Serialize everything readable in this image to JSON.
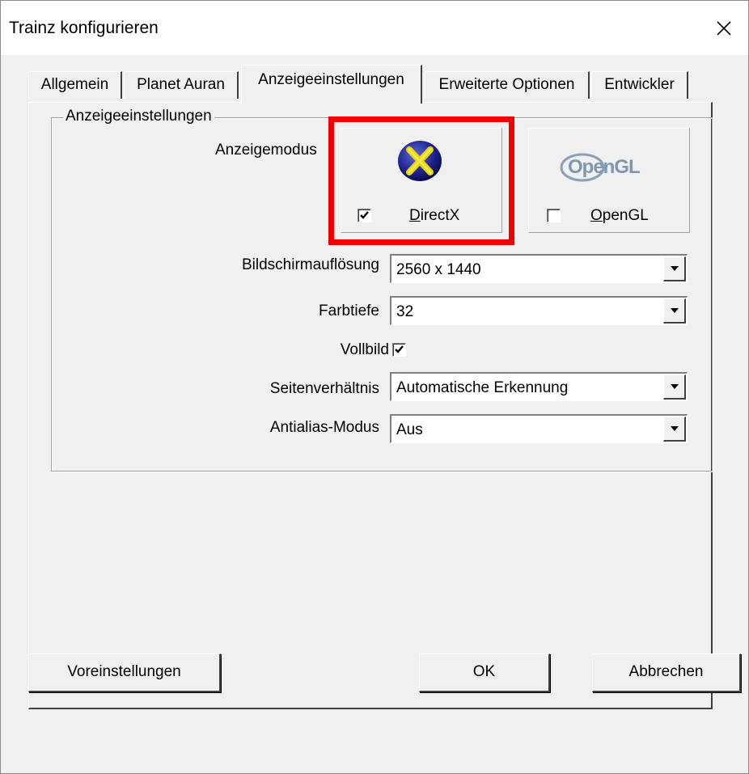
{
  "window": {
    "title": "Trainz konfigurieren"
  },
  "tabs": [
    {
      "label": "Allgemein"
    },
    {
      "label": "Planet Auran"
    },
    {
      "label": "Anzeigeeinstellungen",
      "active": true
    },
    {
      "label": "Erweiterte Optionen"
    },
    {
      "label": "Entwickler"
    }
  ],
  "group": {
    "title": "Anzeigeeinstellungen"
  },
  "display_mode": {
    "label": "Anzeigemodus",
    "directx": {
      "label_first": "D",
      "label_rest": "irectX",
      "checked": true,
      "icon": "directx-logo-icon"
    },
    "opengl": {
      "label_first": "O",
      "label_rest": "penGL",
      "checked": false,
      "logo_text": "OpenGL",
      "icon": "opengl-logo-icon"
    }
  },
  "fields": {
    "resolution": {
      "label": "Bildschirmauflösung",
      "value": "2560 x 1440"
    },
    "color_depth": {
      "label": "Farbtiefe",
      "value": "32"
    },
    "fullscreen": {
      "label": "Vollbild",
      "checked": true
    },
    "aspect_ratio": {
      "label": "Seitenverhältnis",
      "value": "Automatische Erkennung"
    },
    "antialias": {
      "label": "Antialias-Modus",
      "value": "Aus"
    }
  },
  "buttons": {
    "defaults": "Voreinstellungen",
    "ok": "OK",
    "cancel": "Abbrechen"
  },
  "colors": {
    "highlight": "#f00000",
    "dialog_bg": "#f0f0f0"
  }
}
